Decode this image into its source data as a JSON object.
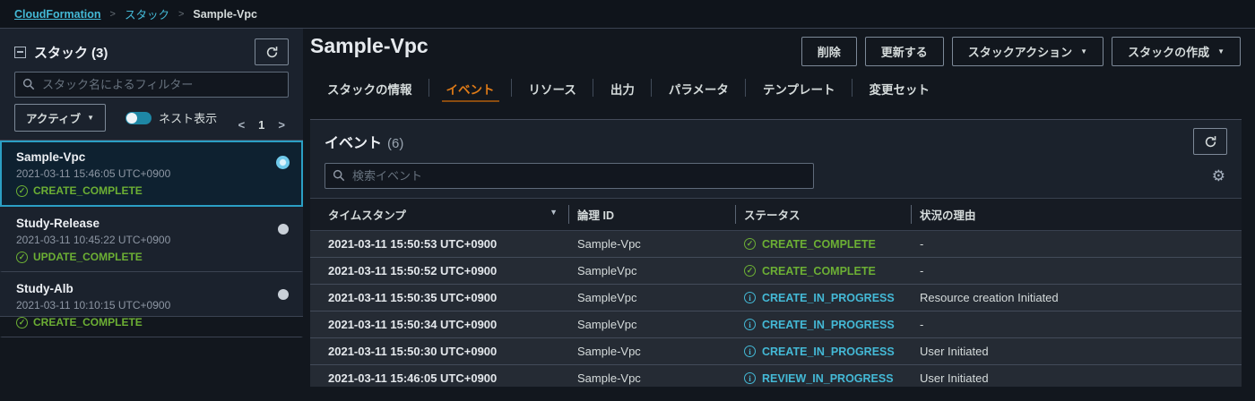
{
  "breadcrumb": {
    "home": "CloudFormation",
    "separator": ">",
    "section": "スタック",
    "current": "Sample-Vpc"
  },
  "sidebar": {
    "title": "スタック",
    "count": "(3)",
    "filter_placeholder": "スタック名によるフィルター",
    "view_filter": "アクティブ",
    "view_filter_caret": "▼",
    "nested_toggle_label": "ネスト表示",
    "pagination": {
      "prev": "<",
      "page": "1",
      "next": ">"
    },
    "stacks": [
      {
        "name": "Sample-Vpc",
        "timestamp": "2021-03-11 15:46:05 UTC+0900",
        "status": "CREATE_COMPLETE",
        "kind": "ok"
      },
      {
        "name": "Study-Release",
        "timestamp": "2021-03-11 10:45:22 UTC+0900",
        "status": "UPDATE_COMPLETE",
        "kind": "ok"
      },
      {
        "name": "Study-Alb",
        "timestamp": "2021-03-11 10:10:15 UTC+0900",
        "status": "CREATE_COMPLETE",
        "kind": "ok"
      }
    ]
  },
  "header": {
    "title": "Sample-Vpc",
    "buttons": [
      {
        "label": "削除"
      },
      {
        "label": "更新する"
      },
      {
        "label": "スタックアクション",
        "caret": "▼"
      },
      {
        "label": "スタックの作成",
        "caret": "▼"
      }
    ]
  },
  "tabs": [
    {
      "label": "スタックの情報"
    },
    {
      "label": "イベント"
    },
    {
      "label": "リソース"
    },
    {
      "label": "出力"
    },
    {
      "label": "パラメータ"
    },
    {
      "label": "テンプレート"
    },
    {
      "label": "変更セット"
    }
  ],
  "events": {
    "title": "イベント",
    "count": "(6)",
    "search_placeholder": "検索イベント",
    "sort_caret": "▼",
    "columns": {
      "timestamp": "タイムスタンプ",
      "logical_id": "論理 ID",
      "status": "ステータス",
      "reason": "状況の理由"
    },
    "rows": [
      {
        "timestamp": "2021-03-11 15:50:53 UTC+0900",
        "logical_id": "Sample-Vpc",
        "status": "CREATE_COMPLETE",
        "kind": "ok",
        "reason": "-"
      },
      {
        "timestamp": "2021-03-11 15:50:52 UTC+0900",
        "logical_id": "SampleVpc",
        "status": "CREATE_COMPLETE",
        "kind": "ok",
        "reason": "-"
      },
      {
        "timestamp": "2021-03-11 15:50:35 UTC+0900",
        "logical_id": "SampleVpc",
        "status": "CREATE_IN_PROGRESS",
        "kind": "info",
        "reason": "Resource creation Initiated"
      },
      {
        "timestamp": "2021-03-11 15:50:34 UTC+0900",
        "logical_id": "SampleVpc",
        "status": "CREATE_IN_PROGRESS",
        "kind": "info",
        "reason": "-"
      },
      {
        "timestamp": "2021-03-11 15:50:30 UTC+0900",
        "logical_id": "Sample-Vpc",
        "status": "CREATE_IN_PROGRESS",
        "kind": "info",
        "reason": "User Initiated"
      },
      {
        "timestamp": "2021-03-11 15:46:05 UTC+0900",
        "logical_id": "Sample-Vpc",
        "status": "REVIEW_IN_PROGRESS",
        "kind": "info",
        "reason": "User Initiated"
      }
    ]
  },
  "icons": {
    "gear_char": "⚙",
    "collapse-panel-icon": "square-with-minus",
    "refresh-icon": "circular-arrow",
    "search-icon": "magnifier",
    "check-circle-icon": "check in circle",
    "info-circle-icon": "i in circle",
    "sort-descending-icon": "▼",
    "caret-down-icon": "▼"
  },
  "colors": {
    "accent_orange": "#e07b17",
    "link_blue": "#44b9d6",
    "success_green": "#6caf34",
    "info_blue": "#44b9d6",
    "selected_border": "#2b9fc4",
    "panel_bg": "#1b222c",
    "row_bg": "#252b34"
  }
}
